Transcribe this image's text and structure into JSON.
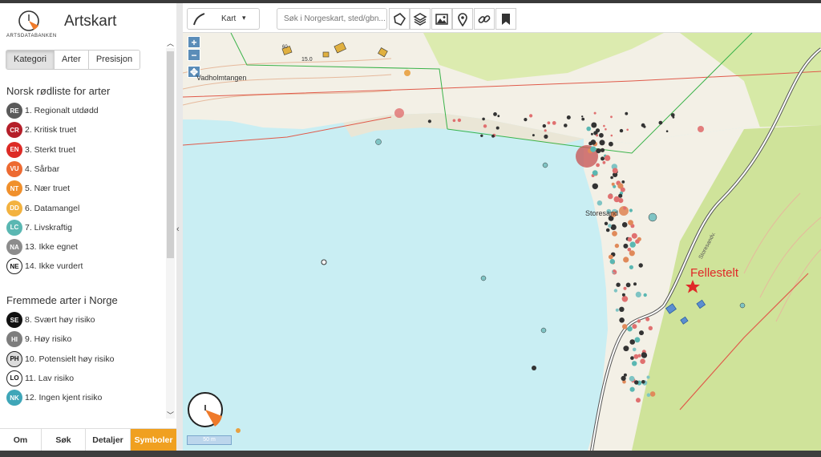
{
  "app": {
    "title": "Artskart",
    "logo_text": "ARTSDATABANKEN"
  },
  "tabs": [
    {
      "label": "Kategori",
      "active": true
    },
    {
      "label": "Arter",
      "active": false
    },
    {
      "label": "Presisjon",
      "active": false
    }
  ],
  "redlist": {
    "title": "Norsk rødliste for arter",
    "items": [
      {
        "code": "RE",
        "label": "1. Regionalt utdødd",
        "color": "#5a5a5a"
      },
      {
        "code": "CR",
        "label": "2. Kritisk truet",
        "color": "#b51f2a"
      },
      {
        "code": "EN",
        "label": "3. Sterkt truet",
        "color": "#dd2b26"
      },
      {
        "code": "VU",
        "label": "4. Sårbar",
        "color": "#ed6a32"
      },
      {
        "code": "NT",
        "label": "5. Nær truet",
        "color": "#f0902c"
      },
      {
        "code": "DD",
        "label": "6. Datamangel",
        "color": "#f3b23f"
      },
      {
        "code": "LC",
        "label": "7. Livskraftig",
        "color": "#5ab7b2"
      },
      {
        "code": "NA",
        "label": "13. Ikke egnet",
        "color": "#8c8c8c"
      },
      {
        "code": "NE",
        "label": "14. Ikke vurdert",
        "color": "#ffffff"
      }
    ]
  },
  "alien": {
    "title": "Fremmede arter i Norge",
    "items": [
      {
        "code": "SE",
        "label": "8. Svært høy risiko",
        "color": "#111111"
      },
      {
        "code": "HI",
        "label": "9. Høy risiko",
        "color": "#7d7d7d"
      },
      {
        "code": "PH",
        "label": "10. Potensielt høy risiko",
        "color": "#dcdcdc"
      },
      {
        "code": "LO",
        "label": "11. Lav risiko",
        "color": "#ffffff"
      },
      {
        "code": "NK",
        "label": "12. Ingen kjent risiko",
        "color": "#3fa6b8"
      }
    ]
  },
  "bottom_nav": [
    {
      "label": "Om",
      "active": false
    },
    {
      "label": "Søk",
      "active": false
    },
    {
      "label": "Detaljer",
      "active": false
    },
    {
      "label": "Symboler",
      "active": true
    }
  ],
  "toolbar": {
    "basemap_label": "Kart",
    "search_placeholder": "Søk i Norgeskart, sted/gbn...",
    "buttons": [
      "polygon-icon",
      "layers-icon",
      "image-icon",
      "location-pin-icon",
      "link-icon",
      "bookmark-icon"
    ]
  },
  "map": {
    "zoom_in": "+",
    "zoom_out": "−",
    "places": [
      "Vadholmtangen",
      "Storesand"
    ],
    "road_label": "Storesandv.",
    "contour_label": "15.0",
    "parcel_label": "60",
    "marker_label": "Fellestelt",
    "scale_label": "50 m",
    "colors": {
      "water": "#c9eef3",
      "forest": "#d6e9a6",
      "meadow": "#f3f0e6",
      "accent": "#f0a020"
    }
  }
}
